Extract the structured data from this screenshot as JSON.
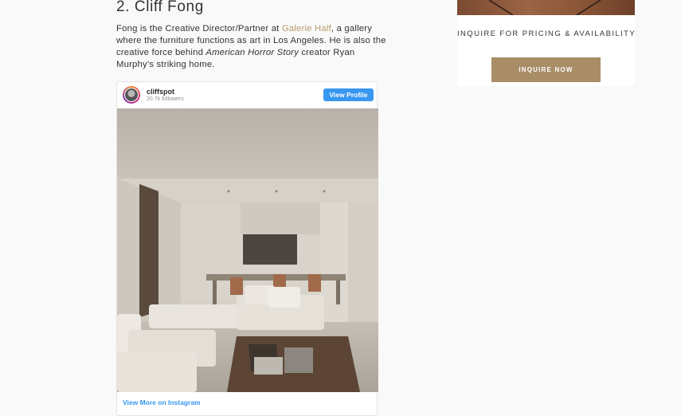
{
  "article": {
    "heading": "2. Cliff Fong",
    "bio": {
      "part1": "Fong is the Creative Director/Partner at ",
      "link": "Galerie Half",
      "part2": ", a gallery where the furniture functions as art in Los Angeles. He is also the creative force behind ",
      "show": "American Horror Story",
      "part3": " creator Ryan Murphy’s striking home."
    }
  },
  "instagram_embed": {
    "username": "cliffspot",
    "followers": "20.7k followers",
    "view_profile_label": "View Profile",
    "view_more_label": "View More on Instagram"
  },
  "sidebar_ad": {
    "text": "INQUIRE FOR PRICING & AVAILABILITY",
    "button_label": "INQUIRE NOW"
  },
  "colors": {
    "link": "#b89a6a",
    "instagram_blue": "#3897f0",
    "ad_button": "#a88d66",
    "page_background": "#f9f9f9"
  }
}
